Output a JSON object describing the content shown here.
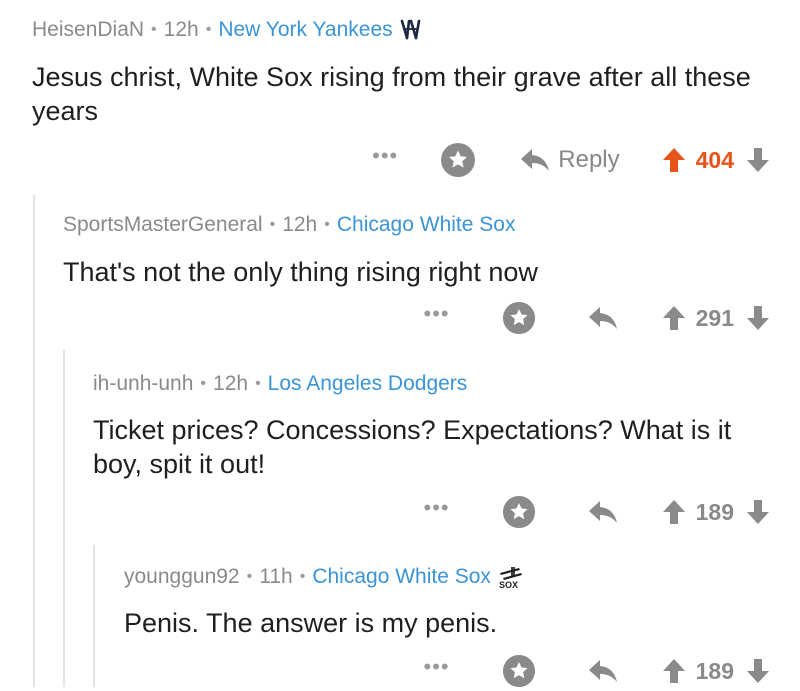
{
  "comments": [
    {
      "username": "HeisenDiaN",
      "age": "12h",
      "flair": "New York Yankees",
      "flair_icon": "yankees-logo-icon",
      "text": "Jesus christ, White Sox rising from their grave after all these years",
      "reply_label": "Reply",
      "score": "404",
      "upvoted": true
    },
    {
      "username": "SportsMasterGeneral",
      "age": "12h",
      "flair": "Chicago White Sox",
      "text": "That's not the only thing rising right now",
      "score": "291",
      "upvoted": false
    },
    {
      "username": "ih-unh-unh",
      "age": "12h",
      "flair": "Los Angeles Dodgers",
      "text": "Ticket prices? Concessions? Expectations? What is it boy, spit it out!",
      "score": "189",
      "upvoted": false
    },
    {
      "username": "younggun92",
      "age": "11h",
      "flair": "Chicago White Sox",
      "flair_icon": "white-sox-logo-icon",
      "text": "Penis. The answer is my penis.",
      "score": "189",
      "upvoted": false
    }
  ],
  "separator": "•",
  "more_glyph": "•••",
  "colors": {
    "flair": "#3a94d6",
    "upvote_active": "#e8531a",
    "meta": "#8a8a8a",
    "thread_line": "#e3e3e3"
  }
}
